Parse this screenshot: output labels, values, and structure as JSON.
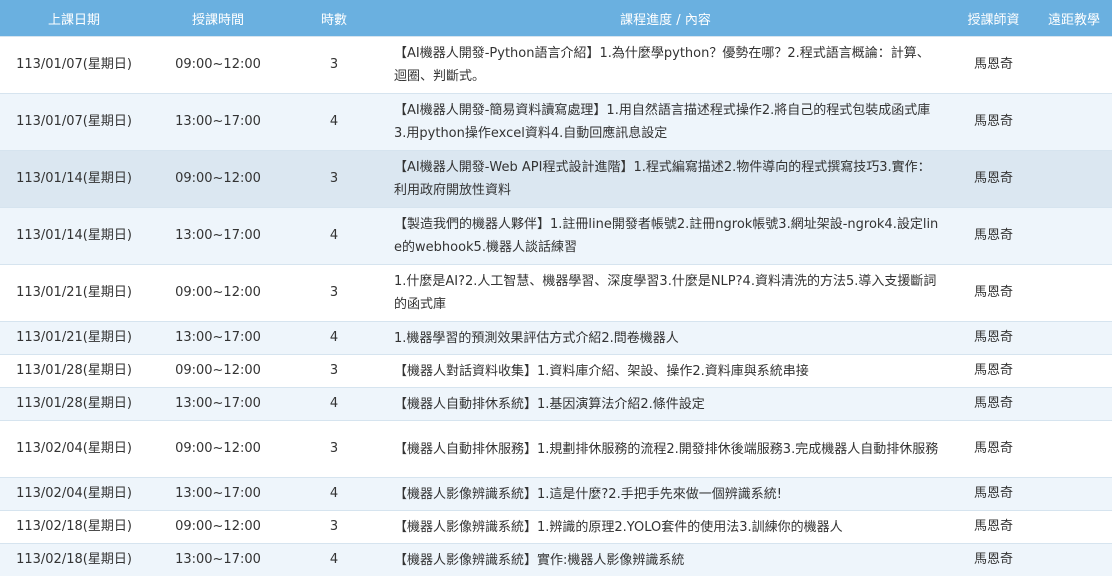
{
  "header": {
    "date": "上課日期",
    "time": "授課時間",
    "hours": "時數",
    "content": "課程進度 / 內容",
    "teacher": "授課師資",
    "remote": "遠距教學"
  },
  "rows": [
    {
      "date": "113/01/07(星期日)",
      "time": "09:00~12:00",
      "hours": "3",
      "content": "【AI機器人開發-Python語言介紹】1.為什麼學python？優勢在哪？2.程式語言概論：計算、迴圈、判斷式。",
      "teacher": "馬恩奇",
      "remote": ""
    },
    {
      "date": "113/01/07(星期日)",
      "time": "13:00~17:00",
      "hours": "4",
      "content": "【AI機器人開發-簡易資料讀寫處理】1.用自然語言描述程式操作2.將自己的程式包裝成函式庫3.用python操作excel資料4.自動回應訊息設定",
      "teacher": "馬恩奇",
      "remote": ""
    },
    {
      "date": "113/01/14(星期日)",
      "time": "09:00~12:00",
      "hours": "3",
      "content": "【AI機器人開發-Web API程式設計進階】1.程式編寫描述2.物件導向的程式撰寫技巧3.實作：利用政府開放性資料",
      "teacher": "馬恩奇",
      "remote": ""
    },
    {
      "date": "113/01/14(星期日)",
      "time": "13:00~17:00",
      "hours": "4",
      "content": "【製造我們的機器人夥伴】1.註冊line開發者帳號2.註冊ngrok帳號3.網址架設-ngrok4.設定line的webhook5.機器人談話練習",
      "teacher": "馬恩奇",
      "remote": ""
    },
    {
      "date": "113/01/21(星期日)",
      "time": "09:00~12:00",
      "hours": "3",
      "content": "1.什麼是AI?2.人工智慧、機器學習、深度學習3.什麼是NLP?4.資料清洗的方法5.導入支援斷詞的函式庫",
      "teacher": "馬恩奇",
      "remote": ""
    },
    {
      "date": "113/01/21(星期日)",
      "time": "13:00~17:00",
      "hours": "4",
      "content": "1.機器學習的預測效果評估方式介紹2.問卷機器人",
      "teacher": "馬恩奇",
      "remote": ""
    },
    {
      "date": "113/01/28(星期日)",
      "time": "09:00~12:00",
      "hours": "3",
      "content": "【機器人對話資料收集】1.資料庫介紹、架設、操作2.資料庫與系統串接",
      "teacher": "馬恩奇",
      "remote": ""
    },
    {
      "date": "113/01/28(星期日)",
      "time": "13:00~17:00",
      "hours": "4",
      "content": "【機器人自動排休系統】1.基因演算法介紹2.條件設定",
      "teacher": "馬恩奇",
      "remote": ""
    },
    {
      "date": "113/02/04(星期日)",
      "time": "09:00~12:00",
      "hours": "3",
      "content": "【機器人自動排休服務】1.規劃排休服務的流程2.開發排休後端服務3.完成機器人自動排休服務",
      "teacher": "馬恩奇",
      "remote": ""
    },
    {
      "date": "113/02/04(星期日)",
      "time": "13:00~17:00",
      "hours": "4",
      "content": "【機器人影像辨識系統】1.這是什麼?2.手把手先來做一個辨識系統!",
      "teacher": "馬恩奇",
      "remote": ""
    },
    {
      "date": "113/02/18(星期日)",
      "time": "09:00~12:00",
      "hours": "3",
      "content": "【機器人影像辨識系統】1.辨識的原理2.YOLO套件的使用法3.訓練你的機器人",
      "teacher": "馬恩奇",
      "remote": ""
    },
    {
      "date": "113/02/18(星期日)",
      "time": "13:00~17:00",
      "hours": "4",
      "content": "【機器人影像辨識系統】實作:機器人影像辨識系統",
      "teacher": "馬恩奇",
      "remote": ""
    }
  ],
  "colors": {
    "header_bg": "#6ab0e0",
    "row_alt_bg": "#eef5fb",
    "row_hover_bg": "#dbe7f1"
  }
}
